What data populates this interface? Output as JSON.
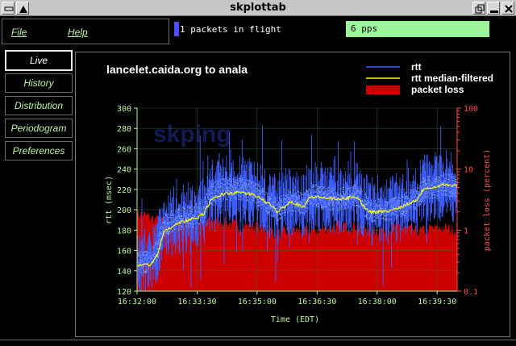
{
  "window": {
    "title": "skplottab"
  },
  "menu": {
    "file": "File",
    "help": "Help"
  },
  "status": {
    "in_flight_text": "1 packets in flight",
    "pps_text": "6 pps",
    "in_flight_color": "#4d4dff",
    "pps_color": "#9df59a"
  },
  "sidebar": {
    "tabs": [
      {
        "label": "Live",
        "active": true
      },
      {
        "label": "History",
        "active": false
      },
      {
        "label": "Distribution",
        "active": false
      },
      {
        "label": "Periodogram",
        "active": false
      },
      {
        "label": "Preferences",
        "active": false
      }
    ]
  },
  "watermark": "skping",
  "chart_data": {
    "type": "line",
    "title": "lancelet.caida.org to anala",
    "xlabel": "Time (EDT)",
    "ylabel": "rtt (msec)",
    "y2label": "packet loss (percent)",
    "x_tick_labels": [
      "16:32:00",
      "16:33:30",
      "16:35:00",
      "16:36:30",
      "16:38:00",
      "16:39:30"
    ],
    "x_ticks_seconds": [
      0,
      90,
      180,
      270,
      360,
      450
    ],
    "xlim_seconds": [
      0,
      480
    ],
    "ylim": [
      120,
      300
    ],
    "y_ticks": [
      120,
      140,
      160,
      180,
      200,
      220,
      240,
      260,
      280,
      300
    ],
    "y2_scale": "log",
    "y2lim": [
      0.1,
      100
    ],
    "y2_ticks": [
      "0.1",
      "1",
      "10",
      "100"
    ],
    "grid": true,
    "legend_position": "top-right",
    "series": [
      {
        "name": "rtt",
        "color": "#3c5cff",
        "x": [
          0,
          10,
          20,
          30,
          40,
          60,
          90,
          100,
          110,
          130,
          160,
          180,
          200,
          210,
          230,
          250,
          260,
          280,
          300,
          330,
          340,
          350,
          360,
          380,
          400,
          420,
          430,
          450,
          460,
          480
        ],
        "y": [
          150,
          148,
          150,
          160,
          185,
          190,
          195,
          200,
          215,
          220,
          220,
          215,
          205,
          200,
          210,
          205,
          215,
          212,
          210,
          215,
          205,
          198,
          200,
          200,
          205,
          212,
          222,
          222,
          225,
          222
        ]
      },
      {
        "name": "rtt median-filtered",
        "color": "#ffff00",
        "x": [
          0,
          10,
          20,
          30,
          40,
          60,
          90,
          100,
          110,
          130,
          160,
          180,
          200,
          210,
          230,
          250,
          260,
          280,
          300,
          330,
          340,
          350,
          360,
          380,
          400,
          420,
          430,
          450,
          460,
          480
        ],
        "y": [
          145,
          146,
          146,
          155,
          178,
          187,
          192,
          196,
          209,
          216,
          217,
          213,
          205,
          198,
          208,
          203,
          213,
          212,
          210,
          213,
          203,
          198,
          198,
          199,
          204,
          210,
          221,
          223,
          225,
          223
        ]
      },
      {
        "name": "packet loss",
        "color": "#cc0000",
        "x": [
          0,
          10,
          20,
          30,
          60,
          90,
          120,
          150,
          180,
          210,
          240,
          270,
          300,
          330,
          360,
          390,
          420,
          450,
          480
        ],
        "y": [
          1.9,
          1.8,
          1.6,
          1.5,
          1.3,
          1.25,
          1.5,
          1.2,
          1.2,
          0.9,
          1.0,
          1.0,
          1.2,
          1.2,
          1.0,
          1.2,
          0.95,
          1.1,
          1.05
        ]
      }
    ]
  }
}
